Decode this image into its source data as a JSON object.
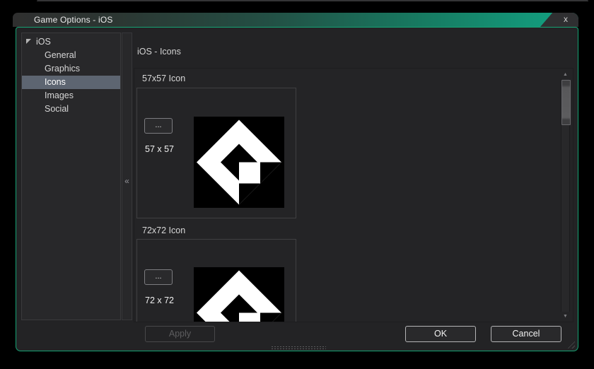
{
  "window": {
    "title": "Game Options - iOS"
  },
  "icons": {
    "close": "x",
    "collapse_left": "«",
    "scroll_up": "▲",
    "scroll_down": "▼"
  },
  "sidebar": {
    "root": "iOS",
    "items": [
      {
        "label": "General",
        "selected": false
      },
      {
        "label": "Graphics",
        "selected": false
      },
      {
        "label": "Icons",
        "selected": true
      },
      {
        "label": "Images",
        "selected": false
      },
      {
        "label": "Social",
        "selected": false
      }
    ]
  },
  "content": {
    "header": "iOS - Icons",
    "sections": [
      {
        "group_label": "57x57 Icon",
        "browse_label": "...",
        "size_label": "57 x 57"
      },
      {
        "group_label": "72x72 Icon",
        "browse_label": "...",
        "size_label": "72 x 72"
      }
    ]
  },
  "footer": {
    "apply": "Apply",
    "ok": "OK",
    "cancel": "Cancel"
  },
  "colors": {
    "titlebar_accent": "#12a383",
    "window_border": "#16a374",
    "selected_row": "#5d6571",
    "body_bg": "#232325",
    "canvas_bg": "#000000"
  }
}
